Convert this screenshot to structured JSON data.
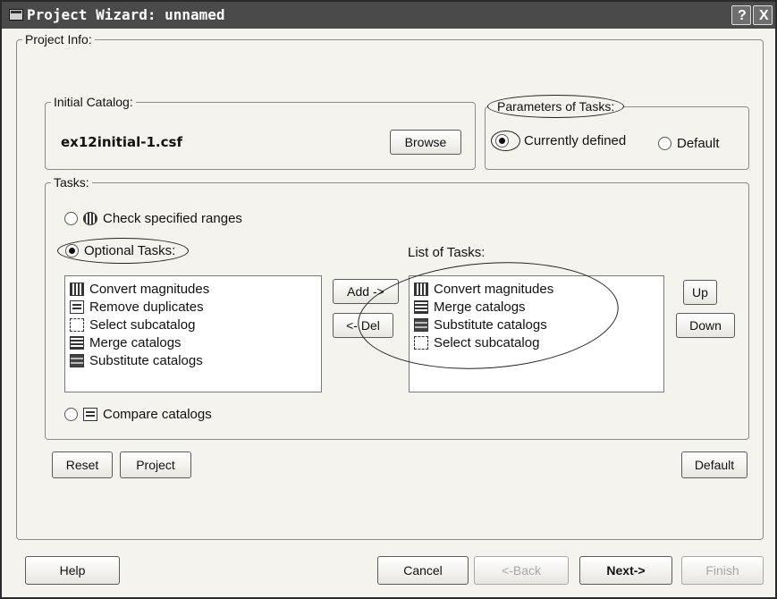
{
  "window": {
    "title": "Project Wizard: unnamed",
    "help_glyph": "?",
    "close_glyph": "X"
  },
  "project_info": {
    "legend": "Project Info:"
  },
  "initial_catalog": {
    "legend": "Initial Catalog:",
    "filename": "ex12initial-1.csf",
    "browse_label": "Browse"
  },
  "parameters": {
    "legend": "Parameters of Tasks:",
    "option_current": "Currently defined",
    "option_default": "Default",
    "selected": "Currently defined"
  },
  "tasks": {
    "legend": "Tasks:",
    "check_ranges_label": "Check specified ranges",
    "optional_tasks_label": "Optional Tasks:",
    "list_of_tasks_label": "List of Tasks:",
    "compare_catalogs_label": "Compare catalogs",
    "selected_option": "Optional Tasks:",
    "optional_items": [
      {
        "label": "Convert magnitudes",
        "icon": "convert-magnitudes-icon"
      },
      {
        "label": "Remove duplicates",
        "icon": "remove-duplicates-icon"
      },
      {
        "label": "Select subcatalog",
        "icon": "select-subcatalog-icon"
      },
      {
        "label": "Merge catalogs",
        "icon": "merge-catalogs-icon"
      },
      {
        "label": "Substitute catalogs",
        "icon": "substitute-catalogs-icon"
      }
    ],
    "selected_items": [
      {
        "label": "Convert magnitudes",
        "icon": "convert-magnitudes-icon"
      },
      {
        "label": "Merge catalogs",
        "icon": "merge-catalogs-icon"
      },
      {
        "label": "Substitute catalogs",
        "icon": "substitute-catalogs-icon"
      },
      {
        "label": "Select subcatalog",
        "icon": "select-subcatalog-icon"
      }
    ],
    "add_label": "Add ->",
    "del_label": "<- Del",
    "up_label": "Up",
    "down_label": "Down"
  },
  "project_buttons": {
    "reset": "Reset",
    "project": "Project",
    "default": "Default"
  },
  "footer": {
    "help": "Help",
    "cancel": "Cancel",
    "back": "<-Back",
    "next": "Next->",
    "finish": "Finish"
  },
  "colors": {
    "titlebar": "#4a4a4a",
    "dialog_bg": "#f4f3ee",
    "list_bg": "#ffffff"
  }
}
